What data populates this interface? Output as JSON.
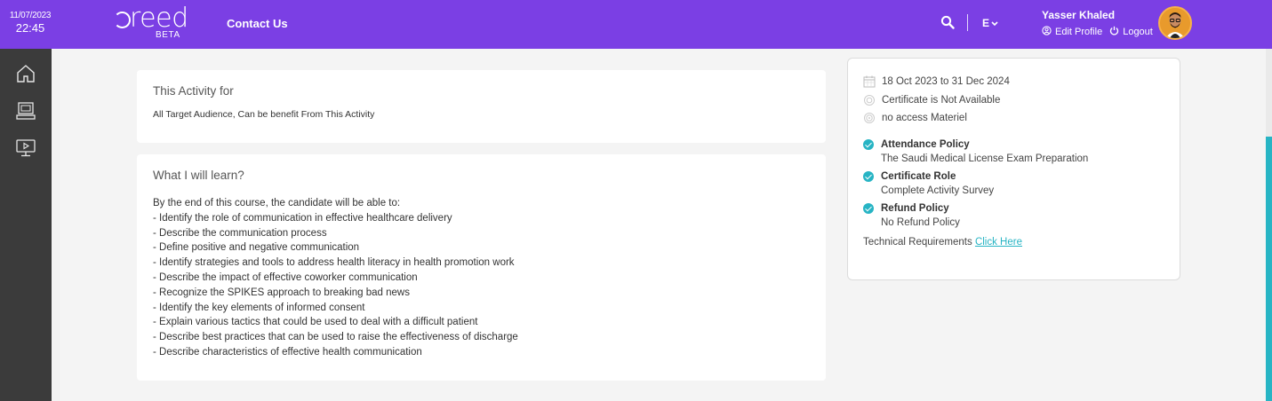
{
  "header": {
    "date": "11/07/2023",
    "time": "22:45",
    "logo_text": "reed",
    "logo_beta": "BETA",
    "contact_label": "Contact Us",
    "lang_label": "E",
    "user_name": "Yasser Khaled",
    "edit_profile_label": "Edit Profile",
    "logout_label": "Logout",
    "brand_color": "#7b3fe4"
  },
  "sidebar": {
    "items": [
      {
        "icon": "home-icon"
      },
      {
        "icon": "courses-icon"
      },
      {
        "icon": "video-icon"
      }
    ]
  },
  "activity": {
    "title": "This Activity for",
    "text": "All Target Audience, Can be benefit From This Activity"
  },
  "learn": {
    "title": "What I will learn?",
    "intro": "By the end of this course, the candidate will be able to:",
    "items": [
      "- Identify the role of communication in effective healthcare delivery",
      "- Describe the communication process",
      "- Define positive and negative communication",
      "- Identify strategies and tools to address health literacy in health promotion work",
      "- Describe the impact of effective coworker communication",
      "- Recognize the SPIKES approach to breaking bad news",
      "- Identify the key elements of informed consent",
      "- Explain various tactics that could be used to deal with a difficult patient",
      "- Describe best practices that can be used to raise the effectiveness of discharge",
      "- Describe characteristics of effective health communication"
    ]
  },
  "info": {
    "date_range": "18 Oct 2023 to 31 Dec 2024",
    "certificate": "Certificate is Not Available",
    "materiel": "no access Materiel",
    "policies": [
      {
        "title": "Attendance Policy",
        "value": "The Saudi Medical License Exam Preparation"
      },
      {
        "title": "Certificate Role",
        "value": "Complete Activity Survey"
      },
      {
        "title": "Refund Policy",
        "value": "No Refund Policy"
      }
    ],
    "tech_label": "Technical Requirements",
    "tech_link": "Click Here",
    "accent_color": "#27b4c4"
  }
}
